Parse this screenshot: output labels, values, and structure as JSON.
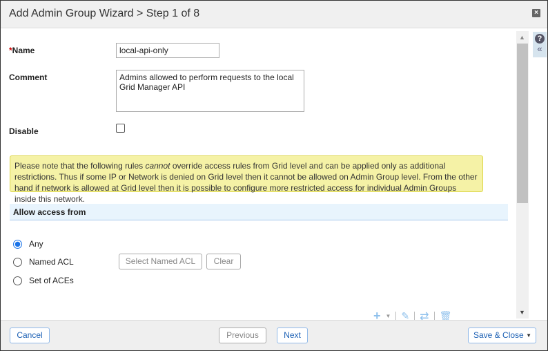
{
  "header": {
    "title": "Add Admin Group Wizard > Step 1 of 8"
  },
  "form": {
    "name_required": "*",
    "name_label": "Name",
    "name_value": "local-api-only",
    "comment_label": "Comment",
    "comment_value": "Admins allowed to perform requests to the local Grid Manager API",
    "disable_label": "Disable",
    "disable_checked": false
  },
  "note": {
    "part1": "Please note that the following rules ",
    "emph": "cannot",
    "part2": " override access rules from Grid level and can be applied only as additional restrictions. Thus if some IP or Network is denied on Grid level then it cannot be allowed on Admin Group level. From the other hand if network is allowed at Grid level then it is possible to configure more restricted access for individual Admin Groups inside this network."
  },
  "access": {
    "title": "Allow access from",
    "options": [
      {
        "label": "Any",
        "selected": true
      },
      {
        "label": "Named ACL",
        "selected": false
      },
      {
        "label": "Set of ACEs",
        "selected": false
      }
    ],
    "select_acl_label": "Select Named ACL",
    "clear_label": "Clear"
  },
  "footer": {
    "cancel": "Cancel",
    "previous": "Previous",
    "next": "Next",
    "save_close": "Save & Close"
  },
  "colors": {
    "accent": "#1a73e8",
    "note_bg": "#f5f2a6",
    "section_bg": "#e8f4fd"
  }
}
